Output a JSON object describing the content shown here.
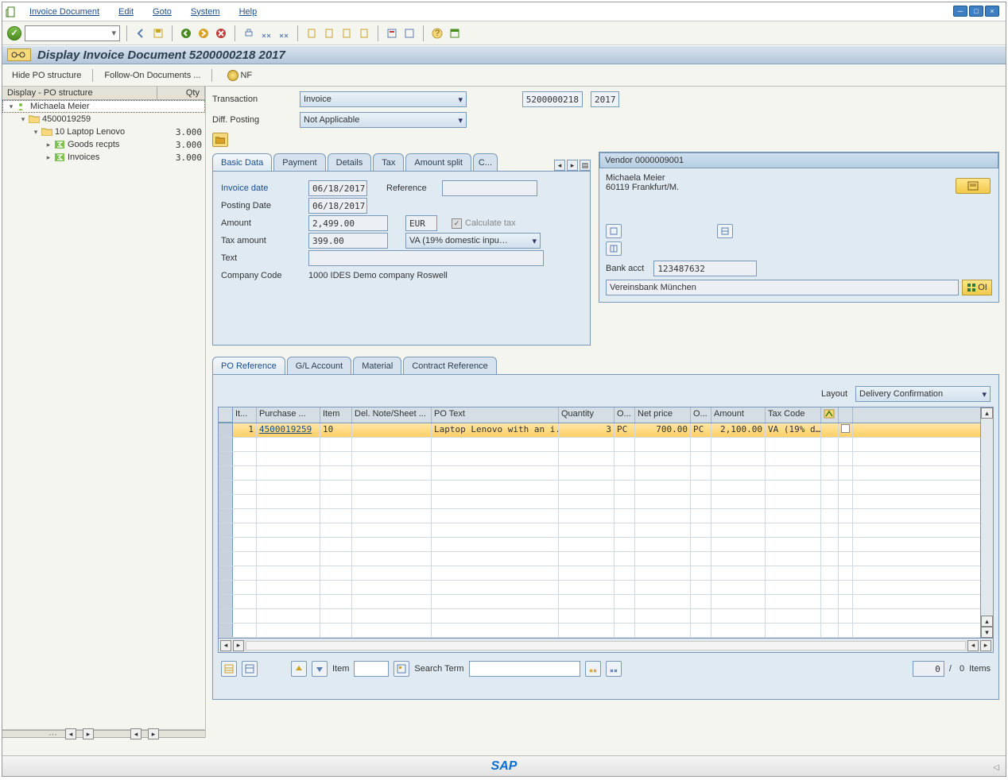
{
  "menu": {
    "items": [
      "Invoice Document",
      "Edit",
      "Goto",
      "System",
      "Help"
    ]
  },
  "title": "Display Invoice Document 5200000218 2017",
  "appButtons": {
    "hidePO": "Hide PO structure",
    "followOn": "Follow-On Documents ...",
    "nf": "NF"
  },
  "tree": {
    "headerName": "Display - PO structure",
    "headerQty": "Qty",
    "rows": [
      {
        "indent": 0,
        "exp": "▾",
        "icon": "person",
        "label": "Michaela Meier",
        "qty": "",
        "sel": true
      },
      {
        "indent": 1,
        "exp": "▾",
        "icon": "folder",
        "label": "4500019259",
        "qty": ""
      },
      {
        "indent": 2,
        "exp": "▾",
        "icon": "folder",
        "label": "10 Laptop Lenovo",
        "qty": "3.000"
      },
      {
        "indent": 3,
        "exp": "▸",
        "icon": "sigma",
        "label": "Goods recpts",
        "qty": "3.000"
      },
      {
        "indent": 3,
        "exp": "▸",
        "icon": "sigma",
        "label": "Invoices",
        "qty": "3.000"
      }
    ]
  },
  "topFields": {
    "transactionLabel": "Transaction",
    "transactionValue": "Invoice",
    "diffPostingLabel": "Diff. Posting",
    "diffPostingValue": "Not Applicable",
    "docNo": "5200000218",
    "year": "2017"
  },
  "tabsUpper": [
    "Basic Data",
    "Payment",
    "Details",
    "Tax",
    "Amount split",
    "C..."
  ],
  "basicData": {
    "invoiceDateLabel": "Invoice date",
    "invoiceDate": "06/18/2017",
    "referenceLabel": "Reference",
    "reference": "",
    "postingDateLabel": "Posting Date",
    "postingDate": "06/18/2017",
    "amountLabel": "Amount",
    "amount": "2,499.00",
    "currency": "EUR",
    "calcTaxLabel": "Calculate tax",
    "taxAmountLabel": "Tax amount",
    "taxAmount": "399.00",
    "taxCode": "VA (19% domestic inpu…",
    "textLabel": "Text",
    "text": "",
    "companyCodeLabel": "Company Code",
    "companyCode": "1000 IDES Demo company Roswell"
  },
  "vendor": {
    "header": "Vendor 0000009001",
    "name": "Michaela Meier",
    "city": "60119 Frankfurt/M.",
    "bankAcctLabel": "Bank acct",
    "bankAcct": "123487632",
    "bankName": "Vereinsbank München",
    "oi": "OI"
  },
  "tabsLower": [
    "PO Reference",
    "G/L Account",
    "Material",
    "Contract Reference"
  ],
  "grid": {
    "layoutLabel": "Layout",
    "layoutValue": "Delivery Confirmation",
    "headers": [
      "It...",
      "Purchase ...",
      "Item",
      "Del. Note/Sheet ...",
      "PO Text",
      "Quantity",
      "O...",
      "Net price",
      "O...",
      "Amount",
      "Tax Code"
    ],
    "row": {
      "it": "1",
      "po": "4500019259",
      "item": "10",
      "del": "",
      "text": "Laptop Lenovo with an i...",
      "qty": "3",
      "oun": "PC",
      "netPrice": "700.00",
      "oun2": "PC",
      "amount": "2,100.00",
      "taxCode": "VA (19% d…"
    },
    "footer": {
      "itemLabel": "Item",
      "searchLabel": "Search Term",
      "countCurrent": "0",
      "countSep": "/",
      "countTotal": "0",
      "itemsLabel": "Items"
    }
  },
  "sapLogo": "SAP"
}
